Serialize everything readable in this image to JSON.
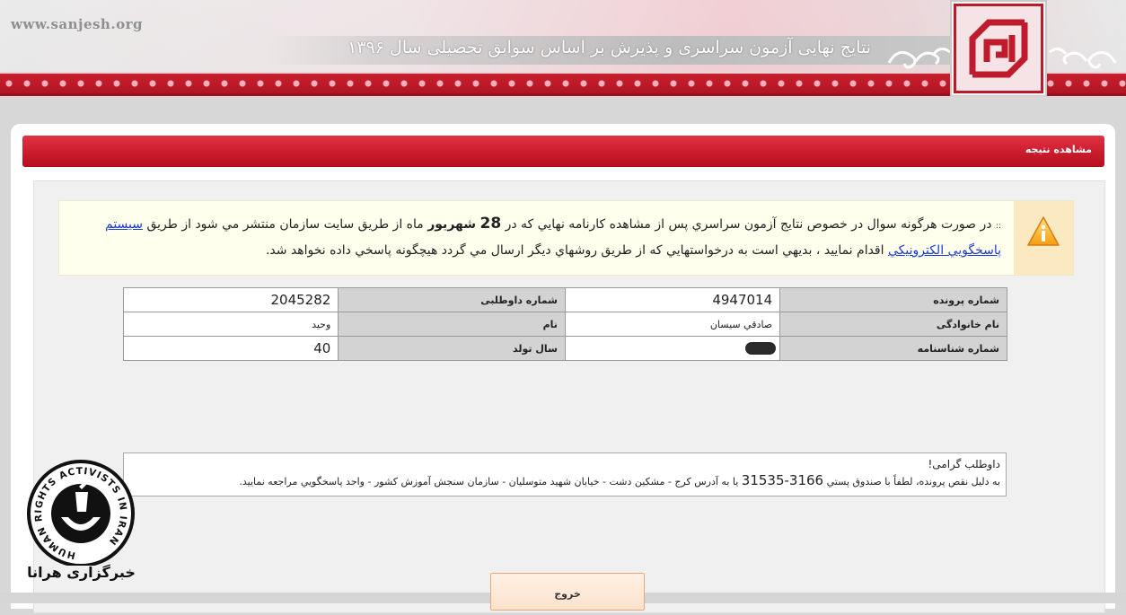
{
  "header": {
    "site_url": "www.sanjesh.org",
    "title": "نتایج نهایی آزمون سراسری و پذیرش بر اساس سوابق تحصیلی سال ۱۳۹۶",
    "accent_color": "#c71a2b"
  },
  "panel": {
    "title": "مشاهده نتيجه"
  },
  "notice": {
    "icon": "warning-icon",
    "bullet": "::",
    "part1": "در صورت هرگونه سوال در خصوص نتايج آزمون سراسري پس از مشاهده کارنامه نهايي که در",
    "date_number": "28",
    "date_month": "شهريور",
    "part2": "ماه از طريق سايت سازمان منتشر مي شود از طريق",
    "link_text": "سيستم پاسخگويي الکترونيکي",
    "part3": "اقدام نماييد ، بديهي است به درخواستهايي که از طريق روشهاي ديگر ارسال مي گردد هيچگونه پاسخي داده نخواهد شد."
  },
  "info": {
    "file_number_label": "شماره پرونده",
    "file_number_value": "4947014",
    "candidate_number_label": "شماره داوطلبی",
    "candidate_number_value": "2045282",
    "family_name_label": "نام خانوادگی",
    "family_name_value": "صادقي سيسان",
    "first_name_label": "نام",
    "first_name_value": "وحيد",
    "id_number_label": "شماره شناسنامه",
    "birth_year_label": "سال تولد",
    "birth_year_value": "40"
  },
  "message": {
    "greeting": "داوطلب گرامی!",
    "body_before_code": "به دليل نقص پرونده، لطفاً با صندوق پستي",
    "postal_code": "31535-3166",
    "body_after_code": "يا به آدرس کرج - مشکين دشت - خيابان شهيد متوسليان - سازمان سنجش آموزش کشور - واحد پاسخگويي مراجعه نماييد."
  },
  "exit_button": {
    "label": "خروج"
  },
  "watermark": {
    "caption": "خبرگزاری هرانا",
    "ring_text": "HUMAN RIGHTS ACTIVISTS IN IRAN"
  }
}
